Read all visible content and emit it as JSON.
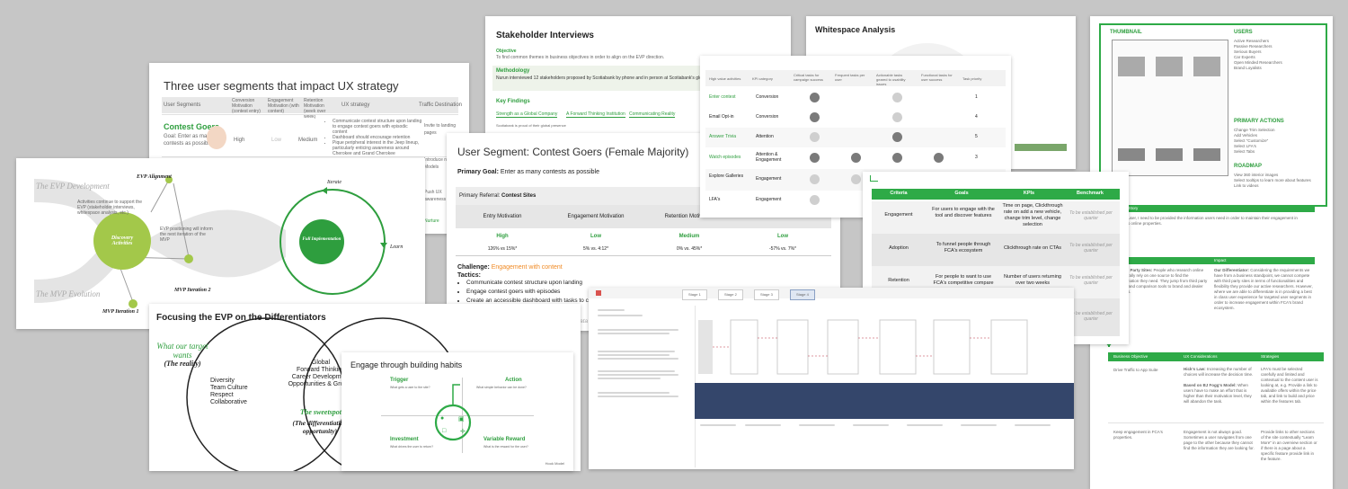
{
  "slides": {
    "segments": {
      "title": "Three user segments that impact UX strategy",
      "columns": [
        "User Segments",
        "Conversion Motivation (contest entry)",
        "Engagement Motivation (with content)",
        "Retention Motivation (week over week)",
        "UX strategy",
        "Traffic Destination"
      ],
      "segment_name": "Contest Goers",
      "segment_goal": "Goal: Enter as many contests as possible.",
      "conversion": "High",
      "engagement": "Low",
      "retention": "Medium",
      "strategy": [
        "Communicate contest structure upon landing to engage contest goers with episodic content",
        "Dashboard should encourage retention",
        "Pique peripheral interest in the Jeep lineup, particularly enticing awareness around Cherokee and Grand Cherokee"
      ],
      "traffic": [
        "Invite to landing pages",
        "Introduce new Models",
        "Push UX awareness",
        "Nurture"
      ]
    },
    "evp": {
      "label_dev": "The EVP Development",
      "label_mvp": "The MVP Evolution",
      "alignment": "EVP Alignment",
      "discovery": "Discovery Activities",
      "full_impl": "Full Implementation",
      "iterate": "Iterate",
      "learn": "Learn",
      "mvp2": "MVP Iteration 2",
      "mvp1": "MVP Iteration 1",
      "note1": "Activities continue to support the EVP (stakeholder interviews, whitespace analysis, etc.)",
      "note2": "EVP positioning will inform the next iteration of the MVP"
    },
    "stakeholder": {
      "title": "Stakeholder Interviews",
      "objective_label": "Objective",
      "objective_text": "To find common themes in business objectives in order to align on the EVP direction.",
      "methodology_label": "Methodology",
      "methodology_text": "Nurun interviewed 12 stakeholders proposed by Scotiabank by phone and in person at Scotiabank's global 15th.",
      "findings_label": "Key Findings",
      "findings": [
        "Strength as a Global Company",
        "A Forward Thinking Institution",
        "Communicating Reality"
      ],
      "finding_note": "Scotiabank is proud of their global presence"
    },
    "contest": {
      "title": "User Segment: Contest Goers (Female Majority)",
      "primary_goal_label": "Primary Goal:",
      "primary_goal": "Enter as many contests as possible",
      "referral_label": "Primary Referral:",
      "referral": "Contest Sites",
      "cols": [
        "Entry Motivation",
        "Engagement Motivation",
        "Retention Motivation",
        ""
      ],
      "levels": [
        "High",
        "Low",
        "Medium",
        "Low"
      ],
      "stats": [
        "126% vs 15%*",
        "5% vs. 4:12*",
        "0% vs. 45%*",
        "-57% vs. 7%*"
      ],
      "challenge_label": "Challenge:",
      "challenge": "Engagement with content",
      "tactics_label": "Tactics:",
      "tactics": [
        "Communicate contest structure upon landing",
        "Engage contest goers with episodes",
        "Create an accessible dashboard with tasks to com"
      ],
      "footnote": "*Numbers are rough estimates based on data from"
    },
    "whitespace": {
      "title": "Whitespace Analysis"
    },
    "activities": {
      "headers": [
        "High value activities",
        "KPI category",
        "Critical tasks for campaign success",
        "Frequent tasks per user",
        "Actionable tasks geared to usability issues",
        "Functional tasks for user success",
        "Task priority"
      ],
      "rows": [
        {
          "activity": "Enter contest",
          "kpi": "Conversion",
          "priority": "1"
        },
        {
          "activity": "Email Opt-in",
          "kpi": "Conversion",
          "priority": "4"
        },
        {
          "activity": "Answer Trivia",
          "kpi": "Attention",
          "priority": "5"
        },
        {
          "activity": "Watch episodes",
          "kpi": "Attention & Engagement",
          "priority": "3"
        },
        {
          "activity": "Explore Galleries",
          "kpi": "Engagement",
          "priority": "2"
        },
        {
          "activity": "LFA's",
          "kpi": "Engagement",
          "priority": ""
        }
      ]
    },
    "kpi": {
      "headers": [
        "Criteria",
        "Goals",
        "KPIs",
        "Benchmark"
      ],
      "rows": [
        {
          "criteria": "Engagement",
          "goal": "For users to engage with the tool and discover features",
          "kpi": "Time on page, Clickthrough rate on add a new vehicle, change trim level, change selection",
          "bench": "To be established per quarter"
        },
        {
          "criteria": "Adoption",
          "goal": "To funnel people through FCA's ecosystem",
          "kpi": "Clickthrough rate on CTAs",
          "bench": "To be established per quarter"
        },
        {
          "criteria": "Retention",
          "goal": "For people to want to use FCA's competitive compare",
          "kpi": "Number of users returning over two weeks",
          "bench": "To be established per quarter"
        },
        {
          "criteria": "",
          "goal": "",
          "kpi": "",
          "bench": "To be established per quarter"
        }
      ]
    },
    "focus": {
      "title": "Focusing the EVP on the Differentiators",
      "want": "What our target wants",
      "reality": "(The reality)",
      "left_items": [
        "Diversity",
        "Team Culture",
        "Respect",
        "Collaborative"
      ],
      "center_items": [
        "Global",
        "Forward Thinking",
        "Career Development",
        "Opportunities & Growth"
      ],
      "sweetspot": "The sweetspot",
      "differentiation": "(The differentiation opportunity)"
    },
    "habits": {
      "title": "Engage through building habits",
      "trigger": "Trigger",
      "trigger_sub": "What gets a user to the site?",
      "action": "Action",
      "action_sub": "What simple behavior can be done?",
      "investment": "Investment",
      "investment_sub": "What drives the user to return?",
      "reward": "Variable Reward",
      "reward_sub": "What is the reward for the user?",
      "footer": "Hook Model"
    },
    "journey": {
      "tabs": [
        "Stage 1",
        "Stage 2",
        "Stage 3",
        "Stage 4"
      ]
    },
    "wireframe": {
      "thumbnail_label": "THUMBNAIL",
      "users_label": "USERS",
      "users": [
        "Active Researchers",
        "Passive Researchers",
        "Serious Buyers",
        "Car Experts",
        "Open Minded Researchers",
        "Brand Loyalists"
      ],
      "primary_actions_label": "PRIMARY ACTIONS",
      "primary_actions": [
        "Change Trim Selection",
        "Add Vehicles",
        "Select \"Customize\"",
        "Select LFA's",
        "Select Tabs"
      ],
      "roadmap_label": "ROADMAP",
      "roadmap": [
        "View 360 interior images",
        "Select tooltips to learn more about features",
        "Link to videos"
      ],
      "lower_headers": [
        "Business Objective",
        "UX Considerations",
        "Strategies"
      ],
      "lower_rows": [
        {
          "obj": "Drive Traffic to App Suite",
          "ux_title": "Hick's Law:",
          "ux": "Increasing the number of choices will increase the decision time.",
          "ux2_title": "Based on BJ Fogg's Model:",
          "ux2": "When users have to make an effort that is higher than their motivation level, they will abandon the task.",
          "strategy": "LFA's must be selected carefully and limited and contextual to the content user is looking at, e.g. Provide a link to available offers within the price tab, and link to build and price within the features tab."
        },
        {
          "obj": "Keep engagement in FCA's properties.",
          "ux_title": "",
          "ux": "Engagement is not always good. Sometimes a user navigates from one page to the other because they cannot find the information they are looking for.",
          "ux2_title": "",
          "ux2": "",
          "strategy": "Provide links to other sections of the site contextually \"Learn More\" in an overview section or if there is a page about a specific feature provide link in the feature."
        }
      ],
      "story_label": "User Story",
      "story": "As a user, I need to be provided the information users need in order to maintain their engagement in FCA's online properties.",
      "impact_label": "Impact",
      "party_title": "Third Party Sites:",
      "party": "People who research online generally rely on one source to find the information they need. They jump from third party sites and comparison tools to brand and dealer pages.",
      "diff_title": "Our Differentiator:",
      "diff": "Considering the requirements we have from a business standpoint, we cannot compete with third party sites in terms of functionalities and flexibility they provide our active researchers. However, where we are able to differentiate is in providing a best in class user experience for targeted user segments in order to increase engagement within FCA's brand ecosystem."
    }
  }
}
